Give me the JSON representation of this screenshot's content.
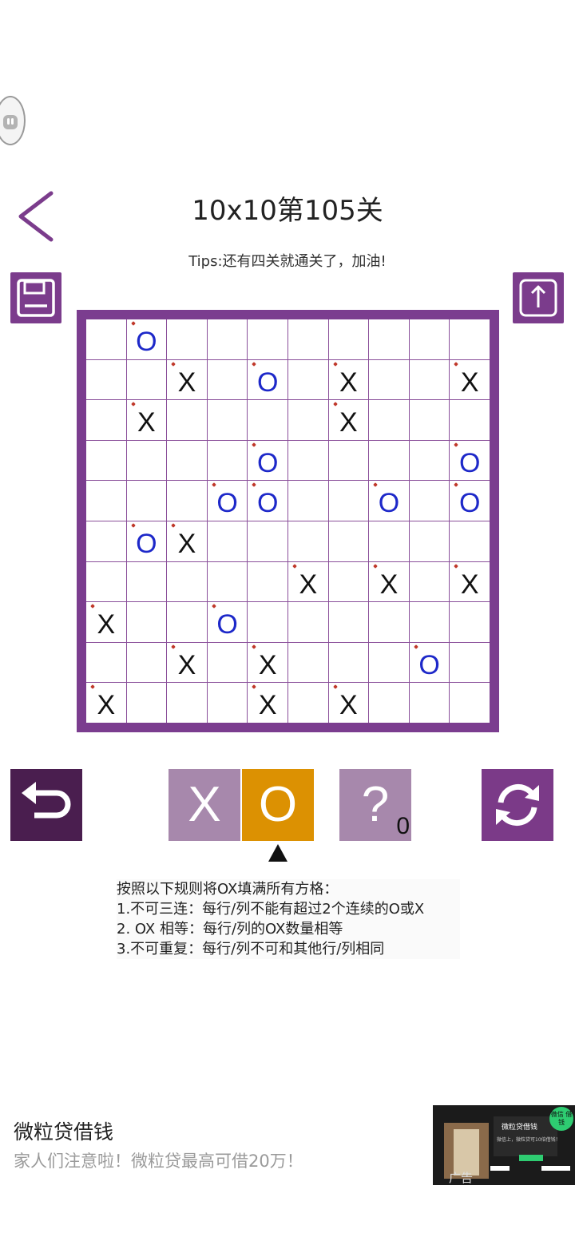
{
  "header": {
    "title": "10x10第105关",
    "tips": "Tips:还有四关就通关了，加油!"
  },
  "icons": {
    "back": "chevron-left-icon",
    "save": "floppy-disk-icon",
    "share": "share-upload-icon",
    "undo": "undo-arrow-icon",
    "refresh": "refresh-cycle-icon"
  },
  "colors": {
    "board": "#7b3d8f",
    "accent_selected": "#dc9102",
    "button_muted": "#a788ac",
    "o_mark": "#1d28c9",
    "x_mark": "#111111"
  },
  "grid": [
    [
      "",
      "O",
      "",
      "",
      "",
      "",
      "",
      "",
      "",
      ""
    ],
    [
      "",
      "",
      "X",
      "",
      "O",
      "",
      "X",
      "",
      "",
      "X"
    ],
    [
      "",
      "X",
      "",
      "",
      "",
      "",
      "X",
      "",
      "",
      ""
    ],
    [
      "",
      "",
      "",
      "",
      "O",
      "",
      "",
      "",
      "",
      "O"
    ],
    [
      "",
      "",
      "",
      "O",
      "O",
      "",
      "",
      "O",
      "",
      "O"
    ],
    [
      "",
      "O",
      "X",
      "",
      "",
      "",
      "",
      "",
      "",
      ""
    ],
    [
      "",
      "",
      "",
      "",
      "",
      "X",
      "",
      "X",
      "",
      "X"
    ],
    [
      "X",
      "",
      "",
      "O",
      "",
      "",
      "",
      "",
      "",
      ""
    ],
    [
      "",
      "",
      "X",
      "",
      "X",
      "",
      "",
      "",
      "O",
      ""
    ],
    [
      "X",
      "",
      "",
      "",
      "X",
      "",
      "X",
      "",
      "",
      ""
    ]
  ],
  "controls": {
    "x_label": "X",
    "o_label": "O",
    "hint_label": "?",
    "hint_count": "0",
    "selected": "O"
  },
  "rules": [
    "按照以下规则将OX填满所有方格：",
    "1.不可三连：每行/列不能有超过2个连续的O或X",
    "2. OX 相等：每行/列的OX数量相等",
    "3.不可重复：每行/列不可和其他行/列相同"
  ],
  "ad": {
    "title": "微粒贷借钱",
    "subtitle": "家人们注意啦！微粒贷最高可借20万！",
    "image_title": "微粒贷借钱",
    "image_text": "微信上，微粒贷可10倍借钱！",
    "badge": "微信 借钱",
    "label": "广告"
  }
}
